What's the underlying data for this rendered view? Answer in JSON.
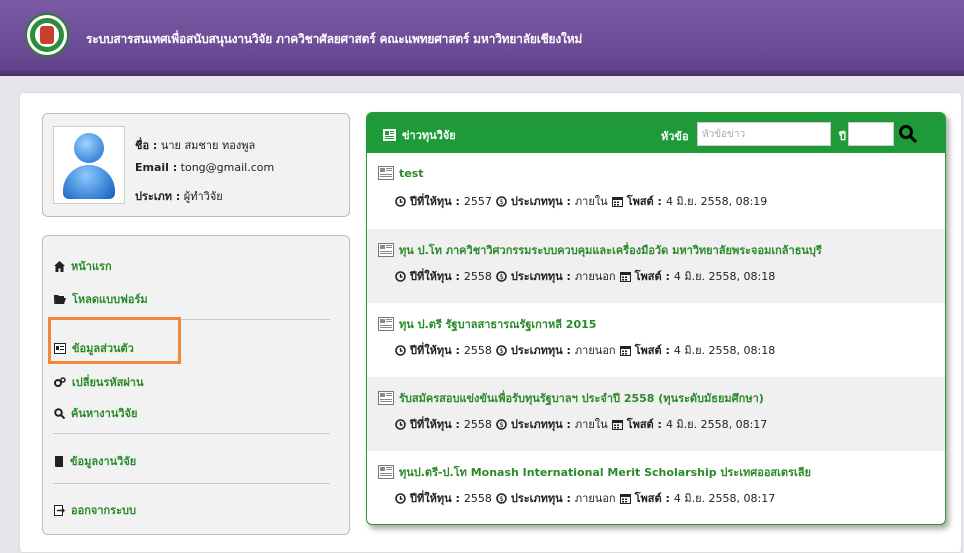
{
  "header": {
    "title": "ระบบสารสนเทศเพื่อสนับสนุนงานวิจัย ภาควิชาศัลยศาสตร์ คณะแพทยศาสตร์ มหาวิทยาลัยเชียงใหม่"
  },
  "profile": {
    "name_label": "ชื่อ :",
    "name_value": "นาย สมชาย ทองพูล",
    "email_label": "Email :",
    "email_value": "tong@gmail.com",
    "type_label": "ประเภท :",
    "type_value": "ผู้ทำวิจัย"
  },
  "menu": {
    "home": "หน้าแรก",
    "download": "โหลดแบบฟอร์ม",
    "profile": "ข้อมูลส่วนตัว",
    "password": "เปลี่ยนรหัสผ่าน",
    "search": "ค้นหางานวิจัย",
    "research": "ข้อมูลงานวิจัย",
    "logout": "ออกจากระบบ"
  },
  "news": {
    "title": "ข่าวทุนวิจัย",
    "topic_label": "หัวข้อ",
    "topic_placeholder": "หัวข้อข่าว",
    "year_label": "ปี",
    "meta_year_label": "ปีที่ให้ทุน :",
    "meta_type_label": "ประเภททุน :",
    "meta_post_label": "โพสต์ :",
    "items": [
      {
        "title": "test",
        "year": "2557",
        "type": "ภายใน",
        "posted": "4 มิ.ย. 2558, 08:19"
      },
      {
        "title": "ทุน ป.โท ภาควิชาวิศวกรรมระบบควบคุมและเครื่องมือวัด มหาวิทยาลัยพระจอมเกล้าธนบุรี",
        "year": "2558",
        "type": "ภายนอก",
        "posted": "4 มิ.ย. 2558, 08:18"
      },
      {
        "title": "ทุน ป.ตรี รัฐบาลสาธารณรัฐเกาหลี 2015",
        "year": "2558",
        "type": "ภายนอก",
        "posted": "4 มิ.ย. 2558, 08:18"
      },
      {
        "title": "รับสมัครสอบแข่งขันเพื่อรับทุนรัฐบาลฯ ประจำปี 2558 (ทุนระดับมัธยมศึกษา)",
        "year": "2558",
        "type": "ภายใน",
        "posted": "4 มิ.ย. 2558, 08:17"
      },
      {
        "title": "ทุนป.ตรี-ป.โท Monash International Merit Scholarship ประเทศออสเตรเลีย",
        "year": "2558",
        "type": "ภายนอก",
        "posted": "4 มิ.ย. 2558, 08:17"
      }
    ]
  },
  "colors": {
    "header": "#6b4a95",
    "accent": "#1f9a38",
    "link": "#2a8a2a",
    "highlight": "#f0873a"
  }
}
